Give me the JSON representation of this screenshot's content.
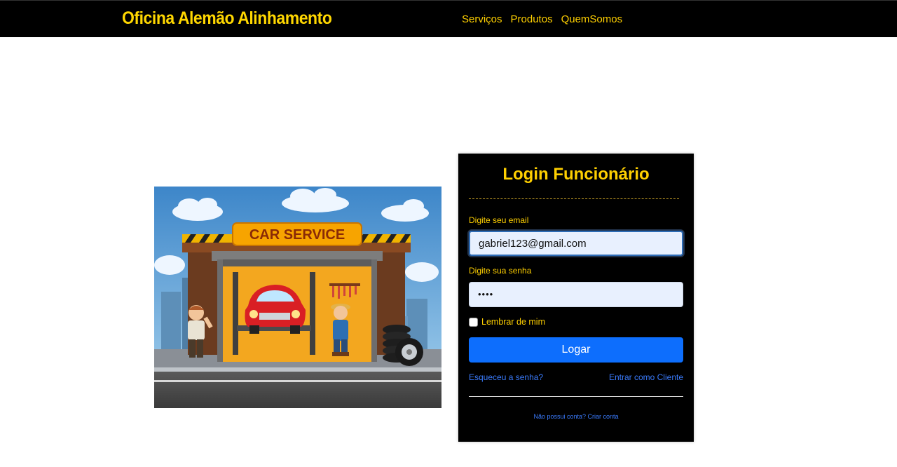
{
  "navbar": {
    "brand": "Oficina Alemão Alinhamento",
    "links": [
      "Serviços",
      "Produtos",
      "QuemSomos"
    ]
  },
  "illustration": {
    "sign_text": "CAR SERVICE"
  },
  "login": {
    "title": "Login Funcionário",
    "email_label": "Digite seu email",
    "email_value": "gabriel123@gmail.com",
    "password_label": "Digite sua senha",
    "password_value": "••••",
    "remember_label": "Lembrar de mim",
    "remember_checked": false,
    "submit_label": "Logar",
    "forgot_label": "Esqueceu a senha?",
    "client_label": "Entrar como Cliente",
    "create_account_label": "Não possui conta? Criar conta"
  },
  "colors": {
    "accent_yellow": "#ffd000",
    "button_blue": "#0d6efd",
    "link_blue": "#3a7bfd",
    "nav_bg": "#000000"
  }
}
